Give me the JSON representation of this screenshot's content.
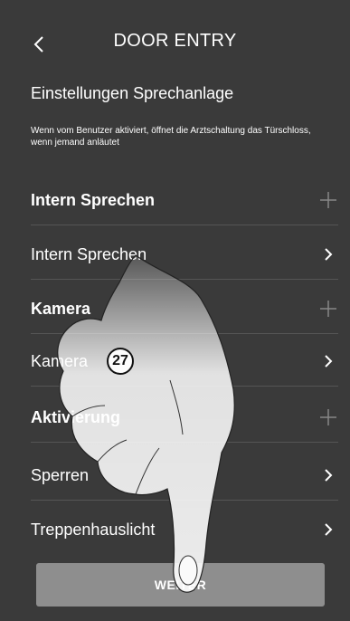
{
  "header": {
    "title": "DOOR ENTRY",
    "back_icon": "chevron-left-icon"
  },
  "section": {
    "title": "Einstellungen Sprechanlage",
    "description": "Wenn vom Benutzer aktiviert, öffnet die Arztschaltung das Türschloss, wenn jemand anläutet"
  },
  "rows": [
    {
      "label": "Intern Sprechen",
      "bold": true,
      "icon": "plus-icon"
    },
    {
      "label": "Intern Sprechen",
      "bold": false,
      "icon": "chevron-right-icon"
    },
    {
      "label": "Kamera",
      "bold": true,
      "icon": "plus-icon"
    },
    {
      "label": "Kamera",
      "bold": false,
      "icon": "chevron-right-icon"
    },
    {
      "label": "Aktivierung",
      "bold": true,
      "icon": "plus-icon"
    },
    {
      "label": "Sperren",
      "bold": false,
      "icon": "chevron-right-icon"
    },
    {
      "label": "Treppenhauslicht",
      "bold": false,
      "icon": "chevron-right-icon"
    }
  ],
  "footer": {
    "button_label": "WEITER"
  },
  "annotation": {
    "step_number": "27"
  },
  "colors": {
    "background": "#3a3a3a",
    "button": "#8e8e8e",
    "text": "#ffffff"
  }
}
